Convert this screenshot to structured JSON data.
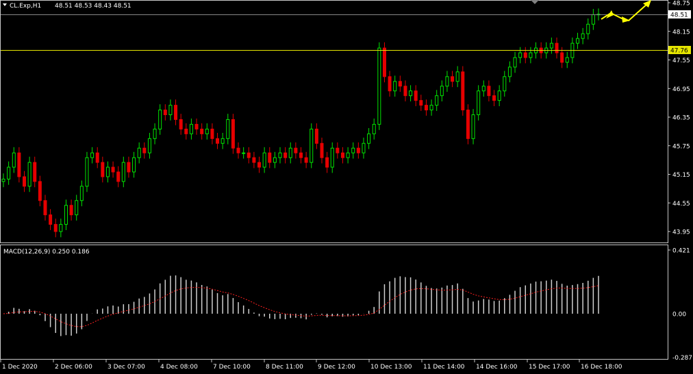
{
  "header": {
    "symbol_label": "CL.Exp,H1",
    "ohlc_text": "48.51 48.53 48.43 48.51"
  },
  "macd_label": "MACD(12,26,9) 0.250 0.186",
  "chart_data": [
    {
      "type": "candlestick",
      "symbol": "CL.Exp",
      "timeframe": "H1",
      "ylim": [
        43.8,
        48.9
      ],
      "y_ticks": [
        "48.75",
        "48.51",
        "48.15",
        "47.55",
        "46.95",
        "46.35",
        "45.75",
        "45.15",
        "44.55",
        "43.95"
      ],
      "last_price_label": "48.51",
      "hline_label": "47.76",
      "hline_value": 47.76,
      "last_price": 48.51,
      "x_labels": [
        "1 Dec 2020",
        "2 Dec 06:00",
        "3 Dec 07:00",
        "4 Dec 08:00",
        "7 Dec 10:00",
        "8 Dec 11:00",
        "9 Dec 12:00",
        "10 Dec 13:00",
        "11 Dec 14:00",
        "14 Dec 16:00",
        "15 Dec 17:00",
        "16 Dec 18:00"
      ],
      "close_series": [
        45.05,
        45.3,
        45.6,
        45.1,
        44.9,
        45.4,
        45.0,
        44.6,
        44.3,
        44.1,
        43.95,
        44.1,
        44.5,
        44.3,
        44.6,
        44.9,
        45.5,
        45.6,
        45.4,
        45.1,
        45.3,
        45.2,
        45.0,
        45.4,
        45.2,
        45.5,
        45.7,
        45.6,
        45.9,
        46.1,
        46.5,
        46.4,
        46.6,
        46.3,
        46.1,
        46.0,
        46.2,
        46.1,
        46.0,
        46.1,
        45.9,
        45.8,
        45.9,
        46.3,
        45.7,
        45.6,
        45.6,
        45.5,
        45.4,
        45.3,
        45.6,
        45.4,
        45.5,
        45.6,
        45.5,
        45.7,
        45.6,
        45.5,
        45.4,
        46.1,
        45.8,
        45.5,
        45.3,
        45.7,
        45.6,
        45.5,
        45.6,
        45.7,
        45.6,
        45.8,
        46.0,
        46.2,
        47.8,
        47.2,
        46.9,
        47.1,
        47.0,
        46.8,
        46.9,
        46.7,
        46.6,
        46.5,
        46.6,
        46.8,
        47.0,
        47.2,
        47.1,
        47.3,
        46.5,
        45.9,
        46.4,
        46.9,
        47.0,
        46.8,
        46.7,
        46.9,
        47.2,
        47.4,
        47.6,
        47.7,
        47.6,
        47.7,
        47.8,
        47.7,
        47.8,
        47.9,
        47.7,
        47.5,
        47.6,
        47.9,
        48.0,
        48.1,
        48.3,
        48.5,
        48.51
      ],
      "projection_label": "",
      "macd": {
        "label": "MACD(12,26,9) 0.250 0.186",
        "main": 0.25,
        "signal": 0.186,
        "ylim": [
          -0.31,
          0.44
        ],
        "y_ticks": [
          "0.421",
          "0.00",
          "-0.287"
        ]
      }
    }
  ]
}
